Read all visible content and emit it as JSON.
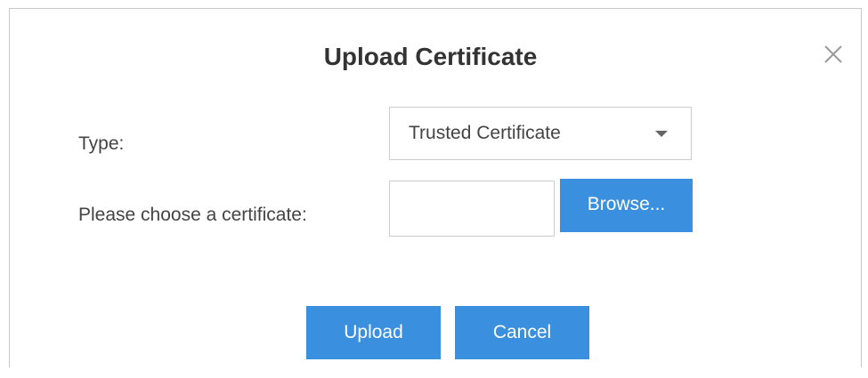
{
  "dialog": {
    "title": "Upload Certificate",
    "close_icon": "close-icon"
  },
  "form": {
    "type_label": "Type:",
    "type_value": "Trusted Certificate",
    "certificate_label": "Please choose a certificate:",
    "certificate_value": "",
    "browse_label": "Browse..."
  },
  "actions": {
    "upload_label": "Upload",
    "cancel_label": "Cancel"
  },
  "colors": {
    "button_blue": "#3a8fde",
    "border": "#cccccc",
    "text": "#444444"
  }
}
